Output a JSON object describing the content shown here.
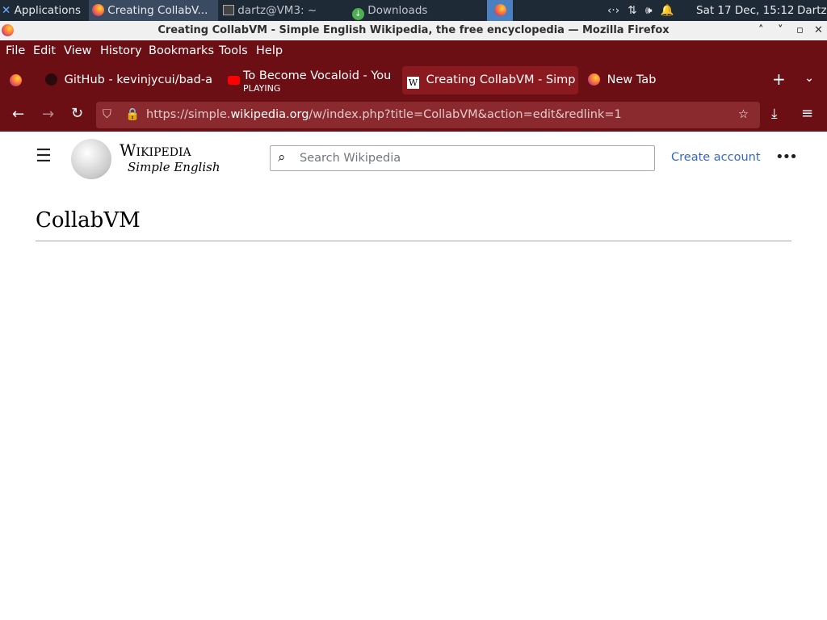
{
  "taskbar": {
    "applications_label": "Applications",
    "tasks": [
      {
        "label": "Creating CollabV..."
      },
      {
        "label": "dartz@VM3: ~"
      },
      {
        "label": "Downloads"
      }
    ],
    "clock": "Sat 17 Dec, 15:12",
    "user": "Dartz"
  },
  "window": {
    "title": "Creating CollabVM - Simple English Wikipedia, the free encyclopedia — Mozilla Firefox"
  },
  "menu": [
    "File",
    "Edit",
    "View",
    "History",
    "Bookmarks",
    "Tools",
    "Help"
  ],
  "tabs": [
    {
      "label": "GitHub - kevinjycui/bad-a"
    },
    {
      "label": "To Become Vocaloid - You",
      "sub": "PLAYING"
    },
    {
      "label": "Creating CollabVM - Simp"
    },
    {
      "label": "New Tab"
    }
  ],
  "url": {
    "prefix": "https://simple.",
    "domain": "wikipedia.org",
    "path": "/w/index.php?title=CollabVM&action=edit&redlink=1"
  },
  "wiki": {
    "wordmark": "Wikipedia",
    "tagline": "Simple English",
    "search_placeholder": "Search Wikipedia",
    "create_account": "Create account",
    "page_title": "CollabVM"
  }
}
